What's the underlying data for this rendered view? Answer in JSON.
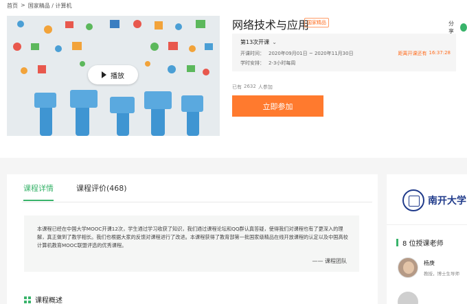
{
  "breadcrumb": {
    "home": "首页",
    "separator": ">",
    "path": "国家精品 / 计算机"
  },
  "hero": {
    "play_label": "播放"
  },
  "course": {
    "title": "网络技术与应用",
    "badge": "国家精品",
    "share_label": "分享",
    "term": "第13次开课",
    "open_time_label": "开课时间：",
    "open_time": "2020年09月01日 ~ 2020年11月30日",
    "study_label": "学时安排：",
    "study_time": "2-3小时每周",
    "countdown_label": "距离开课还有",
    "countdown": "16:37:28",
    "enrolled_prefix": "已有",
    "enrolled_count": "2632",
    "enrolled_suffix": "人参加",
    "join_label": "立即参加"
  },
  "tabs": [
    {
      "label": "课程详情",
      "active": true
    },
    {
      "label": "课程评价(468)",
      "active": false
    }
  ],
  "description": {
    "text": "本课程已经在中国大学MOOC开课12次，学生通过学习收获了知识，我们通过课程论坛和QQ群认真答疑，使得我们对课程也有了更深入的理解，真正做到了教学相长。我们也根据大家的反馈对课程进行了改进。本课程获得了教育部第一批国家级精品在线开放课程的认定以及中国高校计算机教育MOOC联盟评选的优秀课程。",
    "signature": "—— 课程团队"
  },
  "overview_heading": "课程概述",
  "sidebar": {
    "school_name": "南开大学",
    "teachers_heading": "8 位授课老师",
    "teachers": [
      {
        "name": "杨庚",
        "title": "教授，博士生导师"
      }
    ]
  },
  "colors": {
    "accent_green": "#38b36a",
    "join_orange": "#ff7a2e",
    "countdown_orange": "#ff6a1a",
    "school_blue": "#1f3a8a"
  }
}
